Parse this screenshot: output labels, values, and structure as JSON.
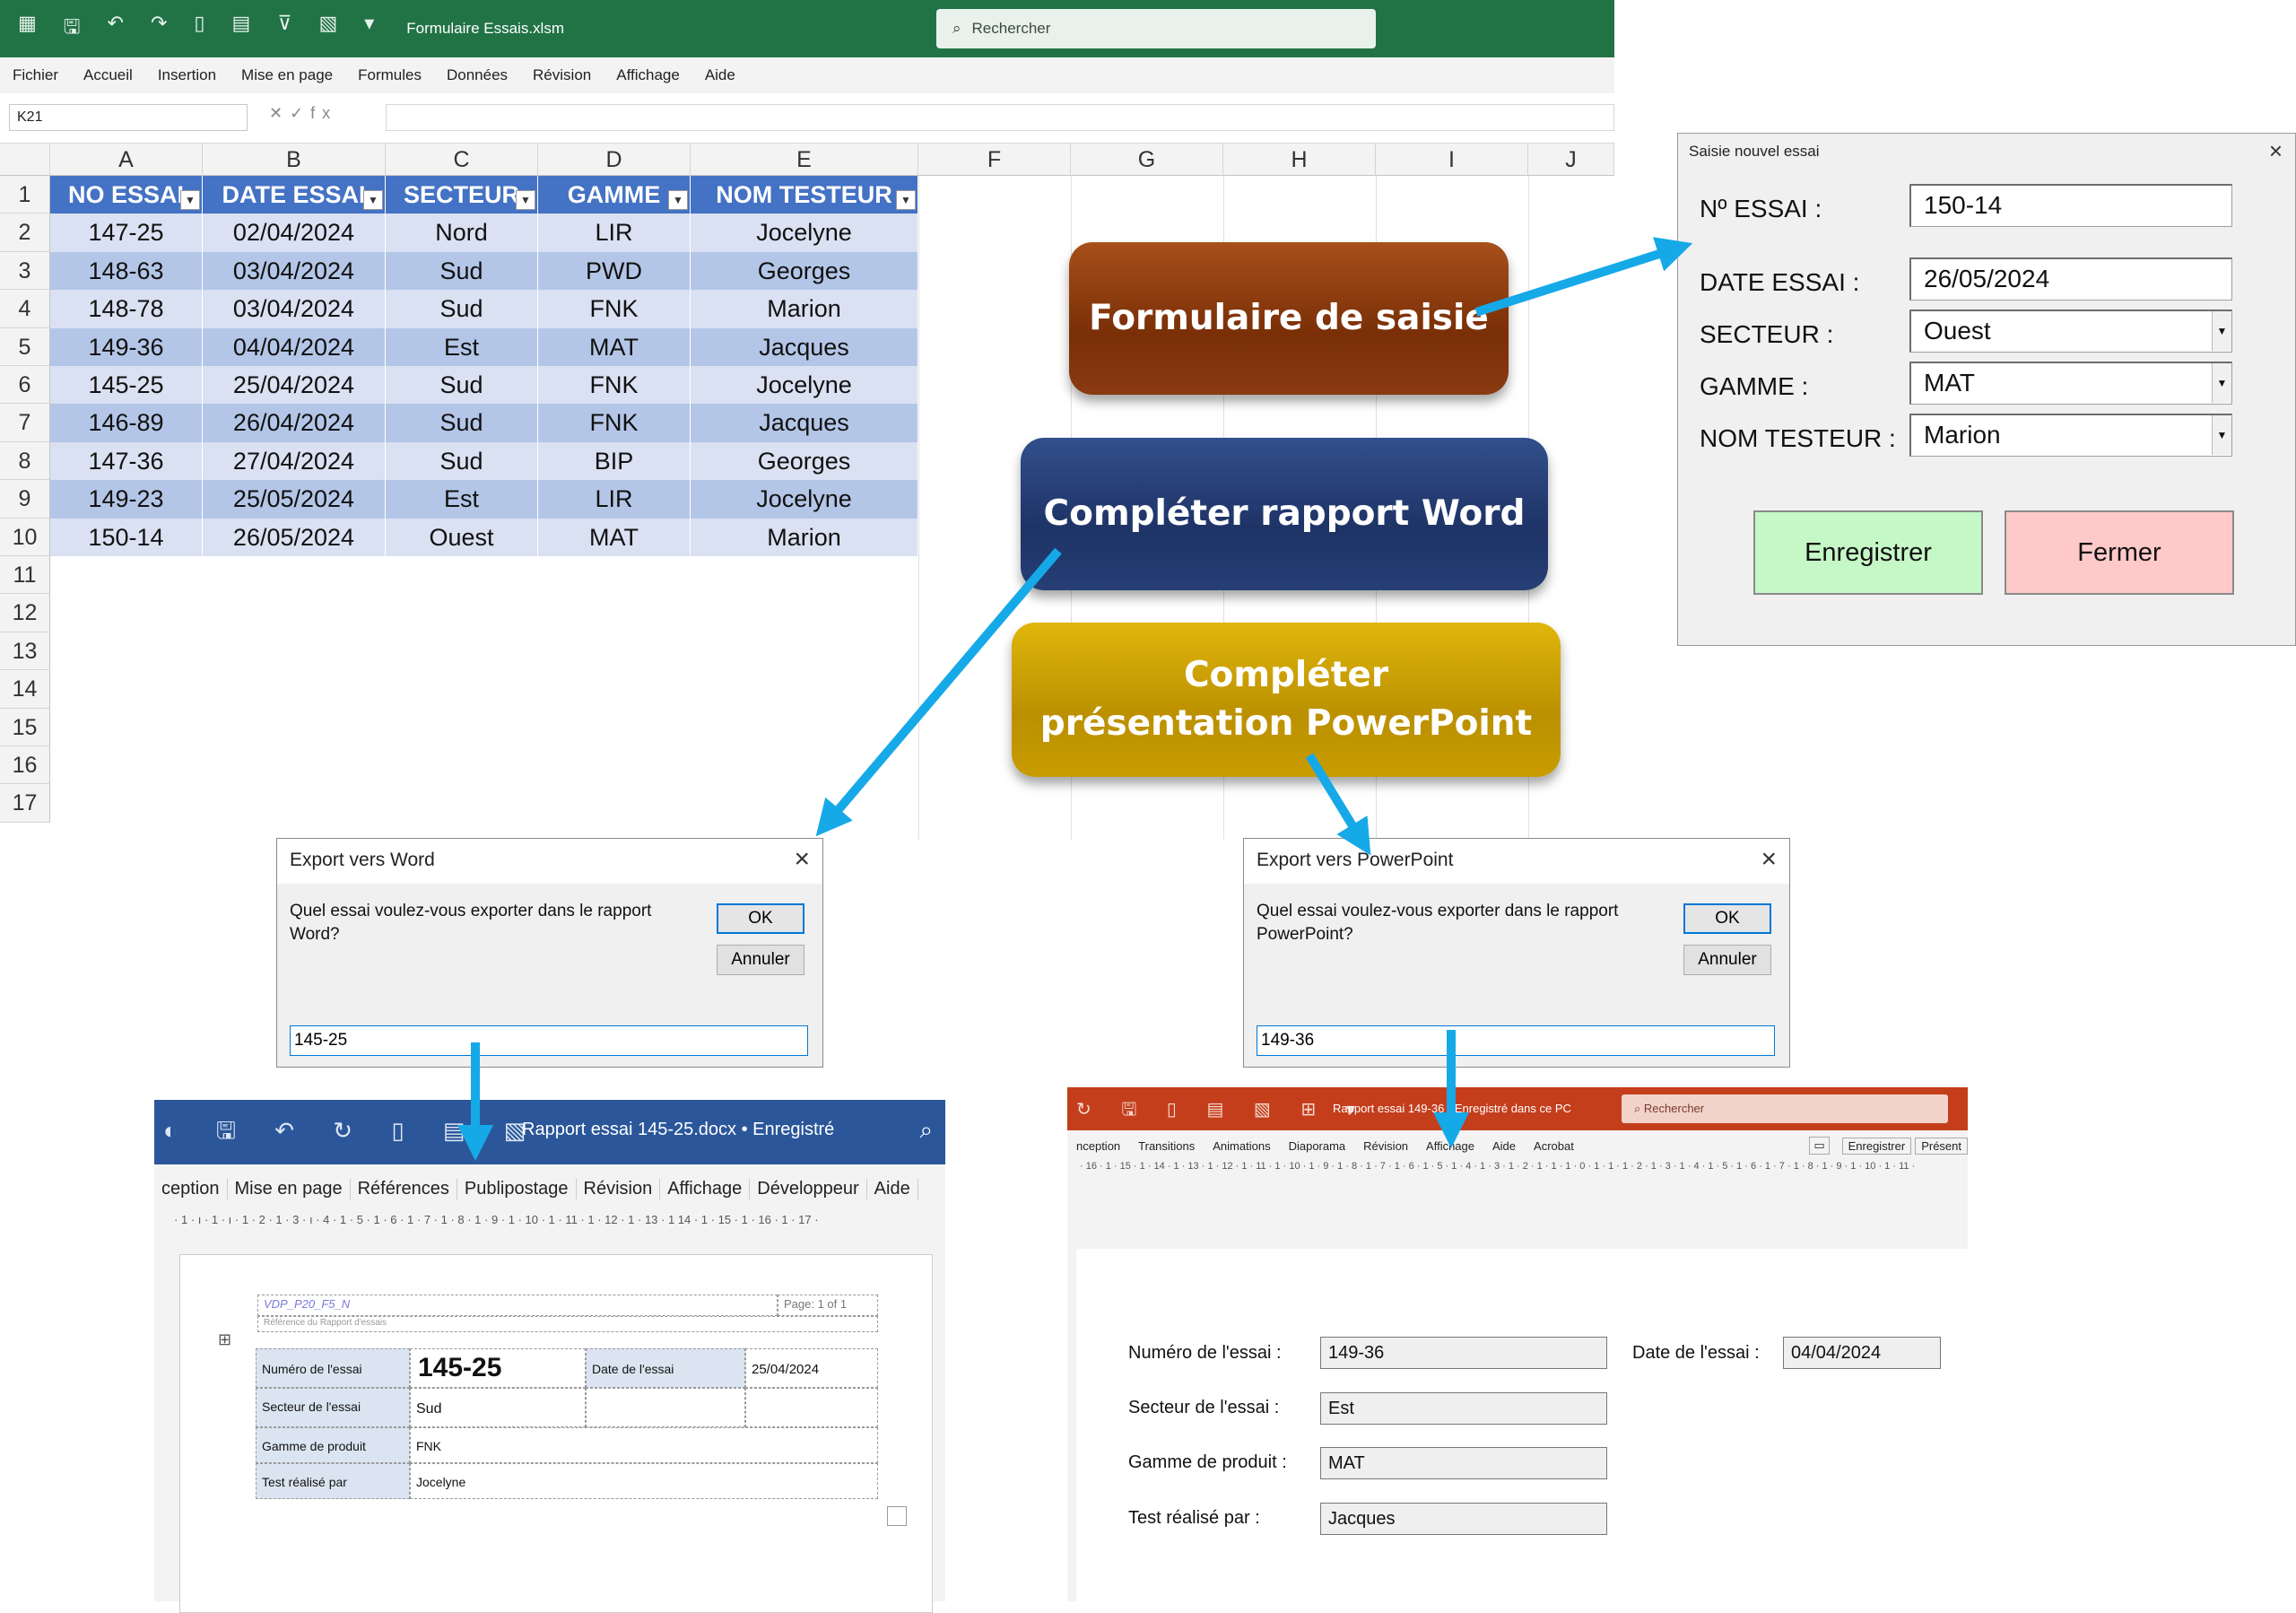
{
  "excel": {
    "filename": "Formulaire Essais.xlsm",
    "search_placeholder": "Rechercher",
    "menu": [
      "Fichier",
      "Accueil",
      "Insertion",
      "Mise en page",
      "Formules",
      "Données",
      "Révision",
      "Affichage",
      "Aide"
    ],
    "name_box": "K21",
    "columns": [
      "A",
      "B",
      "C",
      "D",
      "E",
      "F",
      "G",
      "H",
      "I",
      "J"
    ],
    "row_numbers": [
      "1",
      "2",
      "3",
      "4",
      "5",
      "6",
      "7",
      "8",
      "9",
      "10",
      "11",
      "12",
      "13",
      "14",
      "15",
      "16",
      "17"
    ],
    "table_headers": [
      "NO ESSAI",
      "DATE ESSAI",
      "SECTEUR",
      "GAMME",
      "NOM TESTEUR"
    ],
    "rows": [
      [
        "147-25",
        "02/04/2024",
        "Nord",
        "LIR",
        "Jocelyne"
      ],
      [
        "148-63",
        "03/04/2024",
        "Sud",
        "PWD",
        "Georges"
      ],
      [
        "148-78",
        "03/04/2024",
        "Sud",
        "FNK",
        "Marion"
      ],
      [
        "149-36",
        "04/04/2024",
        "Est",
        "MAT",
        "Jacques"
      ],
      [
        "145-25",
        "25/04/2024",
        "Sud",
        "FNK",
        "Jocelyne"
      ],
      [
        "146-89",
        "26/04/2024",
        "Sud",
        "FNK",
        "Jacques"
      ],
      [
        "147-36",
        "27/04/2024",
        "Sud",
        "BIP",
        "Georges"
      ],
      [
        "149-23",
        "25/05/2024",
        "Est",
        "LIR",
        "Jocelyne"
      ],
      [
        "150-14",
        "26/05/2024",
        "Ouest",
        "MAT",
        "Marion"
      ]
    ]
  },
  "buttons": {
    "form": "Formulaire de saisie",
    "word": "Compléter rapport Word",
    "ppt_line1": "Compléter",
    "ppt_line2": "présentation PowerPoint"
  },
  "form": {
    "title": "Saisie nouvel essai",
    "labels": {
      "num": "Nº ESSAI :",
      "date": "DATE ESSAI :",
      "secteur": "SECTEUR :",
      "gamme": "GAMME :",
      "testeur": "NOM TESTEUR :"
    },
    "values": {
      "num": "150-14",
      "date": "26/05/2024",
      "secteur": "Ouest",
      "gamme": "MAT",
      "testeur": "Marion"
    },
    "save": "Enregistrer",
    "close": "Fermer"
  },
  "word_dialog": {
    "title": "Export vers Word",
    "question": "Quel essai voulez-vous exporter dans le rapport Word?",
    "ok": "OK",
    "cancel": "Annuler",
    "input": "145-25"
  },
  "ppt_dialog": {
    "title": "Export vers PowerPoint",
    "question": "Quel essai voulez-vous exporter dans le rapport PowerPoint?",
    "ok": "OK",
    "cancel": "Annuler",
    "input": "149-36"
  },
  "word": {
    "filename": "Rapport essai 145-25.docx • Enregistré",
    "menu": [
      "ception",
      "Mise en page",
      "Références",
      "Publipostage",
      "Révision",
      "Affichage",
      "Développeur",
      "Aide"
    ],
    "ruler": "· 1 · ı · 1 · ı · 1 · 2 · 1 · 3 · ı · 4 · 1 · 5 · 1 · 6 · 1 · 7 · 1 · 8 · 1 · 9 · 1 · 10 · 1 · 11 · 1 · 12 · 1 · 13 · 1 14 · 1 · 15 · 1 · 16 · 1 · 17 ·",
    "doc_ref": "VDP_P20_F5_N",
    "page": "Page: 1 of 1",
    "doc_subtitle": "Référence du Rapport d'essais",
    "labels": {
      "num": "Numéro de l'essai",
      "date": "Date de l'essai",
      "secteur": "Secteur de l'essai",
      "gamme": "Gamme de produit",
      "test": "Test réalisé par"
    },
    "values": {
      "num": "145-25",
      "date": "25/04/2024",
      "secteur": "Sud",
      "gamme": "FNK",
      "test": "Jocelyne"
    }
  },
  "ppt": {
    "filename": "Rapport essai 149-36 · Enregistré dans ce PC",
    "search_placeholder": "Rechercher",
    "menu": [
      "nception",
      "Transitions",
      "Animations",
      "Diaporama",
      "Révision",
      "Affichage",
      "Aide",
      "Acrobat"
    ],
    "save_btn": "Enregistrer",
    "present_btn": "Présent",
    "ruler": "· 16 · 1 · 15 · 1 · 14 · 1 · 13 · 1 · 12 · 1 · 11 · 1 · 10 · 1 · 9 · 1 · 8 · 1 · 7 · 1 · 6 · 1 · 5 · 1 · 4 · 1 · 3 · 1 · 2 · 1 · 1 · 1 · 0 · 1 · 1 · 1 · 2 · 1 · 3 · 1 · 4 · 1 · 5 · 1 · 6 · 1 · 7 · 1 · 8 · 1 · 9 · 1 · 10 · 1 · 11 ·",
    "labels": {
      "num": "Numéro de l'essai :",
      "date": "Date de l'essai :",
      "secteur": "Secteur de l'essai :",
      "gamme": "Gamme de produit :",
      "test": "Test réalisé par :"
    },
    "values": {
      "num": "149-36",
      "date": "04/04/2024",
      "secteur": "Est",
      "gamme": "MAT",
      "test": "Jacques"
    }
  },
  "colors": {
    "excel": "#217346",
    "word": "#2b579a",
    "ppt": "#c43e1c",
    "arrow": "#16a9e8"
  }
}
